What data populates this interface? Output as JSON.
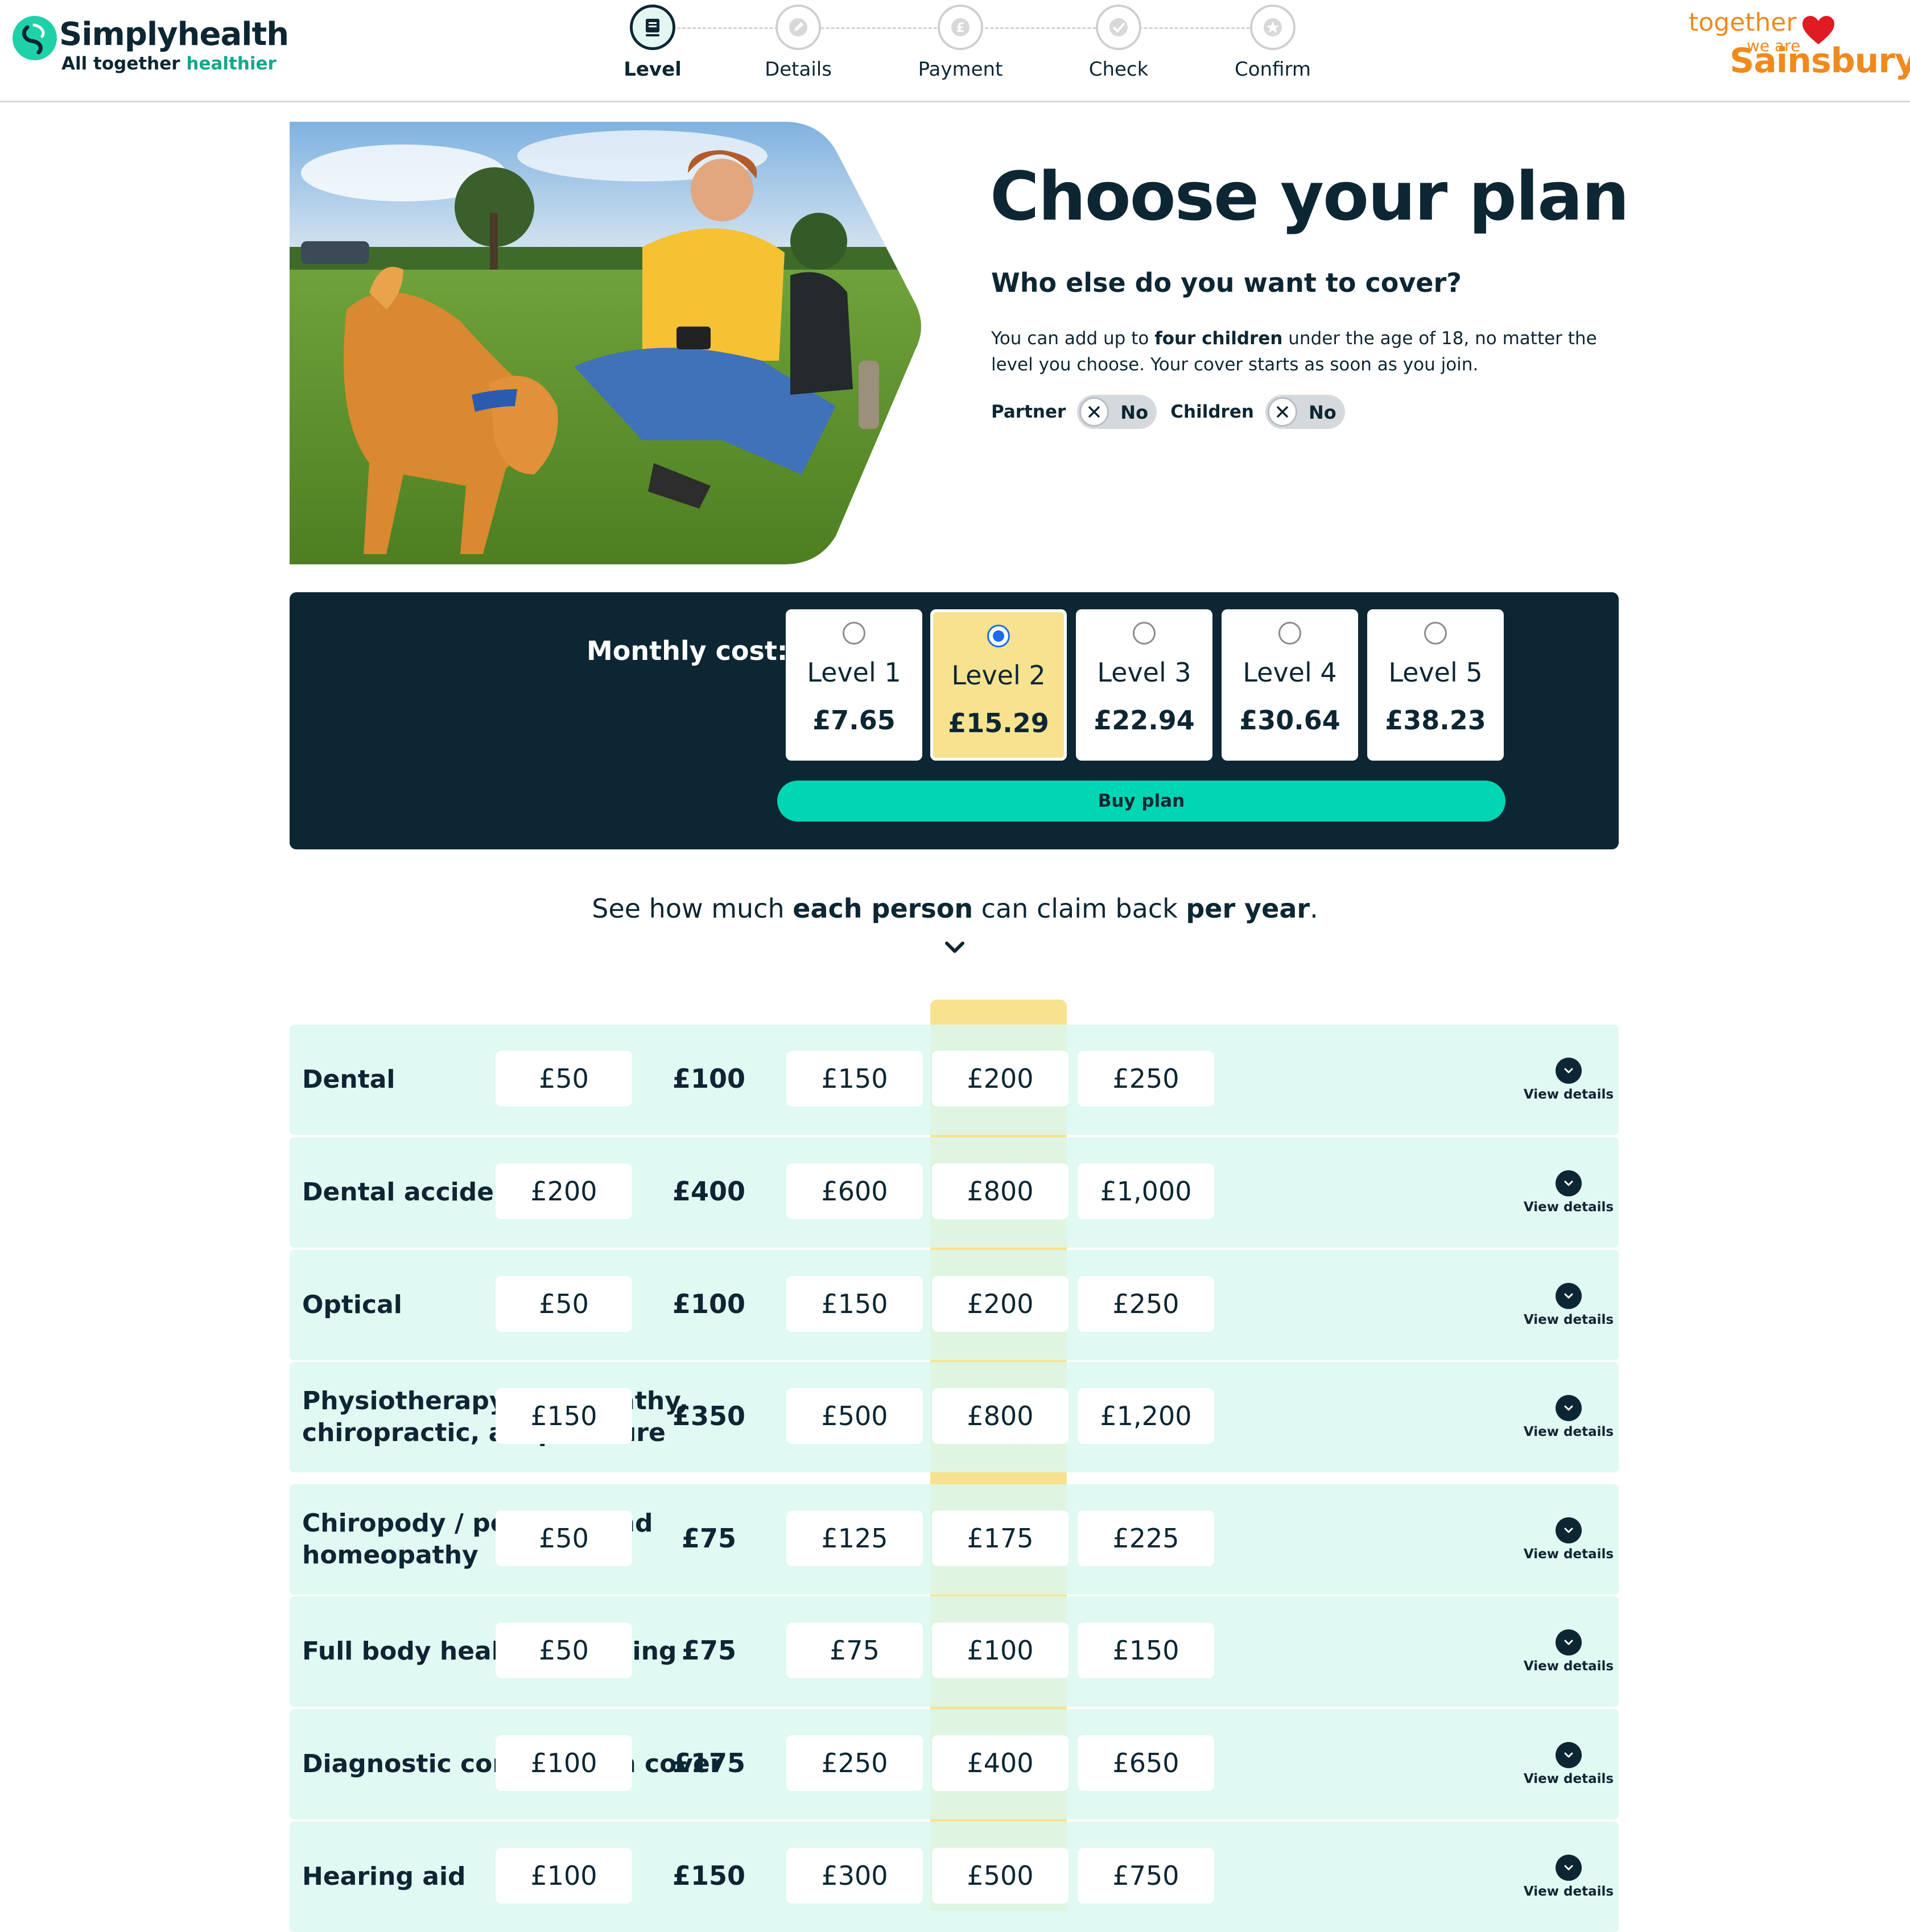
{
  "header": {
    "logo_name": "Simplyhealth",
    "logo_tag_prefix": "All together",
    "logo_tag_highlight": "healthier",
    "steps": [
      {
        "label": "Level",
        "icon": "book-icon",
        "active": true
      },
      {
        "label": "Details",
        "icon": "pencil-icon",
        "active": false
      },
      {
        "label": "Payment",
        "icon": "pound-icon",
        "active": false
      },
      {
        "label": "Check",
        "icon": "check-icon",
        "active": false
      },
      {
        "label": "Confirm",
        "icon": "star-icon",
        "active": false
      }
    ],
    "partner_brand": {
      "line1": "together",
      "line2": "we are",
      "line3": "Sainsbury's",
      "color": "#f08a1d"
    }
  },
  "hero": {
    "title": "Choose your plan",
    "subtitle": "Who else do you want to cover?",
    "desc_1": "You can add up to ",
    "desc_bold": "four children",
    "desc_2": " under the age of 18, no matter the level you choose. Your cover starts as soon as you join.",
    "partner_label": "Partner",
    "partner_value": "No",
    "children_label": "Children",
    "children_value": "No"
  },
  "pricing": {
    "label": "Monthly cost:",
    "levels": [
      {
        "name": "Level 1",
        "price": "£7.65",
        "selected": false
      },
      {
        "name": "Level 2",
        "price": "£15.29",
        "selected": true
      },
      {
        "name": "Level 3",
        "price": "£22.94",
        "selected": false
      },
      {
        "name": "Level 4",
        "price": "£30.64",
        "selected": false
      },
      {
        "name": "Level 5",
        "price": "£38.23",
        "selected": false
      }
    ],
    "buy_label": "Buy plan"
  },
  "claim": {
    "part1": "See how much ",
    "bold1": "each person",
    "part2": " can claim back ",
    "bold2": "per year",
    "part3": "."
  },
  "benefits": {
    "view_details_label": "View details",
    "rows": [
      {
        "name": "Dental",
        "values": [
          "£50",
          "£100",
          "£150",
          "£200",
          "£250"
        ]
      },
      {
        "name": "Dental accident",
        "values": [
          "£200",
          "£400",
          "£600",
          "£800",
          "£1,000"
        ]
      },
      {
        "name": "Optical",
        "values": [
          "£50",
          "£100",
          "£150",
          "£200",
          "£250"
        ]
      },
      {
        "name": "Physiotherapy, osteopathy, chiropractic, acupuncture",
        "values": [
          "£150",
          "£350",
          "£500",
          "£800",
          "£1,200"
        ]
      },
      {
        "name": "Chiropody / podiatry and homeopathy",
        "values": [
          "£50",
          "£75",
          "£125",
          "£175",
          "£225"
        ]
      },
      {
        "name": "Full body health screening",
        "values": [
          "£50",
          "£75",
          "£75",
          "£100",
          "£150"
        ]
      },
      {
        "name": "Diagnostic consultation cover",
        "values": [
          "£100",
          "£175",
          "£250",
          "£400",
          "£650"
        ]
      },
      {
        "name": "Hearing aid",
        "values": [
          "£100",
          "£150",
          "£300",
          "£500",
          "£750"
        ]
      }
    ]
  },
  "colors": {
    "navy": "#0d2633",
    "teal_button": "#00d6b3",
    "selected_yellow": "#f7e28f",
    "row_mint": "#dbf8f1",
    "radio_blue": "#1a6ce8"
  }
}
